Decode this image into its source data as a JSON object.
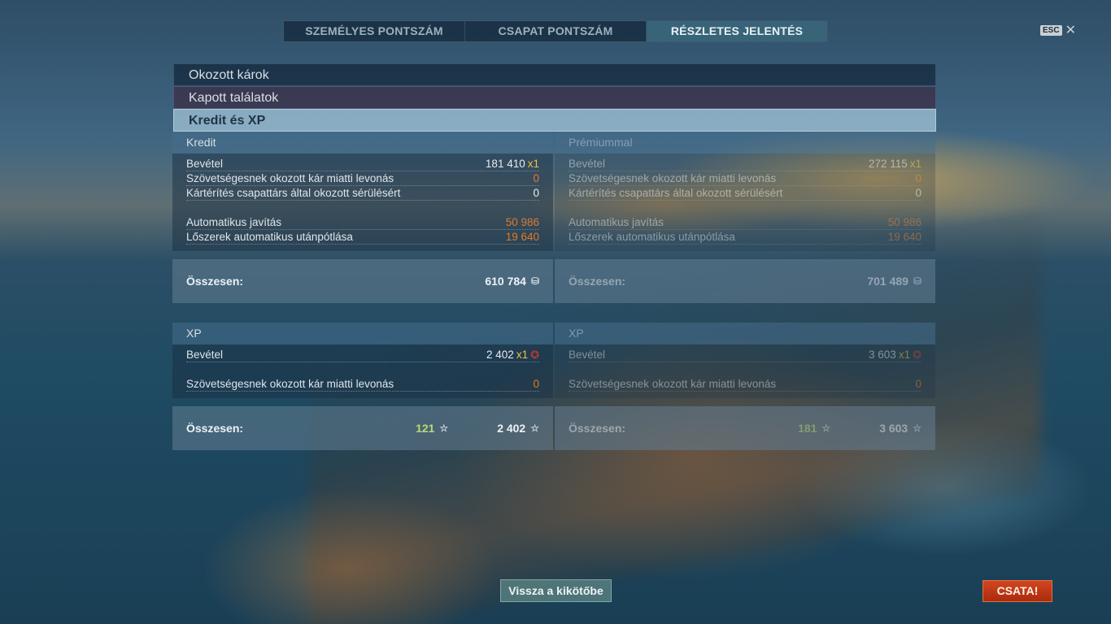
{
  "tabs": [
    "SZEMÉLYES PONTSZÁM",
    "CSAPAT PONTSZÁM",
    "RÉSZLETES JELENTÉS"
  ],
  "esc_label": "ESC",
  "sections": {
    "damage_dealt": "Okozott károk",
    "hits_received": "Kapott találatok",
    "credits_xp": "Kredit és XP"
  },
  "credit": {
    "header": "Kredit",
    "income_label": "Bevétel",
    "income_value": "181 410",
    "multiplier": "x1",
    "ally_damage_label": "Szövetségesnek okozott kár miatti levonás",
    "ally_damage_value": "0",
    "teammate_comp_label": "Kártérítés csapattárs által okozott sérülésért",
    "teammate_comp_value": "0",
    "repair_label": "Automatikus javítás",
    "repair_value": "50 986",
    "ammo_label": "Lőszerek automatikus utánpótlása",
    "ammo_value": "19 640",
    "total_label": "Összesen:",
    "total_value": "610 784"
  },
  "premium_credit": {
    "header": "Prémiummal",
    "income_label": "Bevétel",
    "income_value": "272 115",
    "multiplier": "x1",
    "ally_damage_label": "Szövetségesnek okozott kár miatti levonás",
    "ally_damage_value": "0",
    "teammate_comp_label": "Kártérítés csapattárs által okozott sérülésért",
    "teammate_comp_value": "0",
    "repair_label": "Automatikus javítás",
    "repair_value": "50 986",
    "ammo_label": "Lőszerek automatikus utánpótlása",
    "ammo_value": "19 640",
    "total_label": "Összesen:",
    "total_value": "701 489"
  },
  "xp": {
    "header": "XP",
    "income_label": "Bevétel",
    "income_value": "2 402",
    "multiplier": "x1",
    "ally_damage_label": "Szövetségesnek okozott kár miatti levonás",
    "ally_damage_value": "0",
    "total_label": "Összesen:",
    "free_xp_value": "121",
    "total_value": "2 402"
  },
  "premium_xp": {
    "header": "XP",
    "income_label": "Bevétel",
    "income_value": "3 603",
    "multiplier": "x1",
    "ally_damage_label": "Szövetségesnek okozott kár miatti levonás",
    "ally_damage_value": "0",
    "total_label": "Összesen:",
    "free_xp_value": "181",
    "total_value": "3 603"
  },
  "icons": {
    "credit": "credit-coin-icon",
    "xp": "star-icon",
    "xp_badge": "xp-bonus-icon",
    "close": "close-icon"
  },
  "buttons": {
    "back_to_port": "Vissza a kikötőbe",
    "battle": "CSATA!"
  },
  "colors": {
    "negative_value": "#e07a2a",
    "multiplier": "#e8c24a",
    "free_xp": "#b8d97a",
    "battle_button": "#c0391a"
  }
}
